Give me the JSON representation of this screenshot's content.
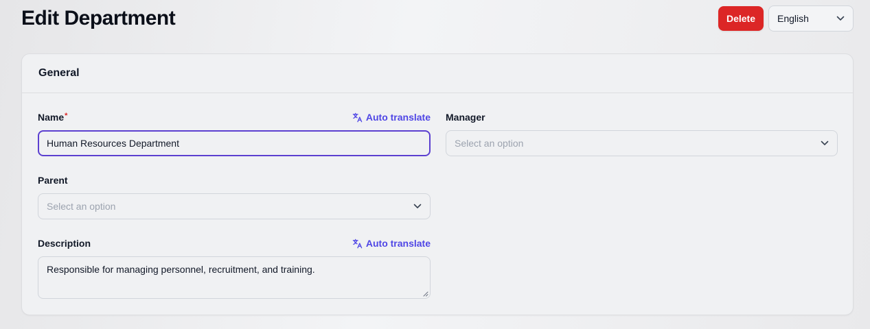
{
  "page": {
    "title": "Edit Department"
  },
  "header": {
    "delete_label": "Delete",
    "language": "English"
  },
  "card": {
    "title": "General"
  },
  "form": {
    "auto_translate_label": "Auto translate",
    "name": {
      "label": "Name",
      "required_mark": "*",
      "value": "Human Resources Department"
    },
    "manager": {
      "label": "Manager",
      "placeholder": "Select an option"
    },
    "parent": {
      "label": "Parent",
      "placeholder": "Select an option"
    },
    "description": {
      "label": "Description",
      "value": "Responsible for managing personnel, recruitment, and training."
    }
  },
  "colors": {
    "accent": "#4f46e5",
    "danger": "#dc2626",
    "focus_ring": "#5b3fd0"
  },
  "icons": [
    "translate-icon",
    "chevron-down-icon",
    "resize-handle-icon"
  ]
}
